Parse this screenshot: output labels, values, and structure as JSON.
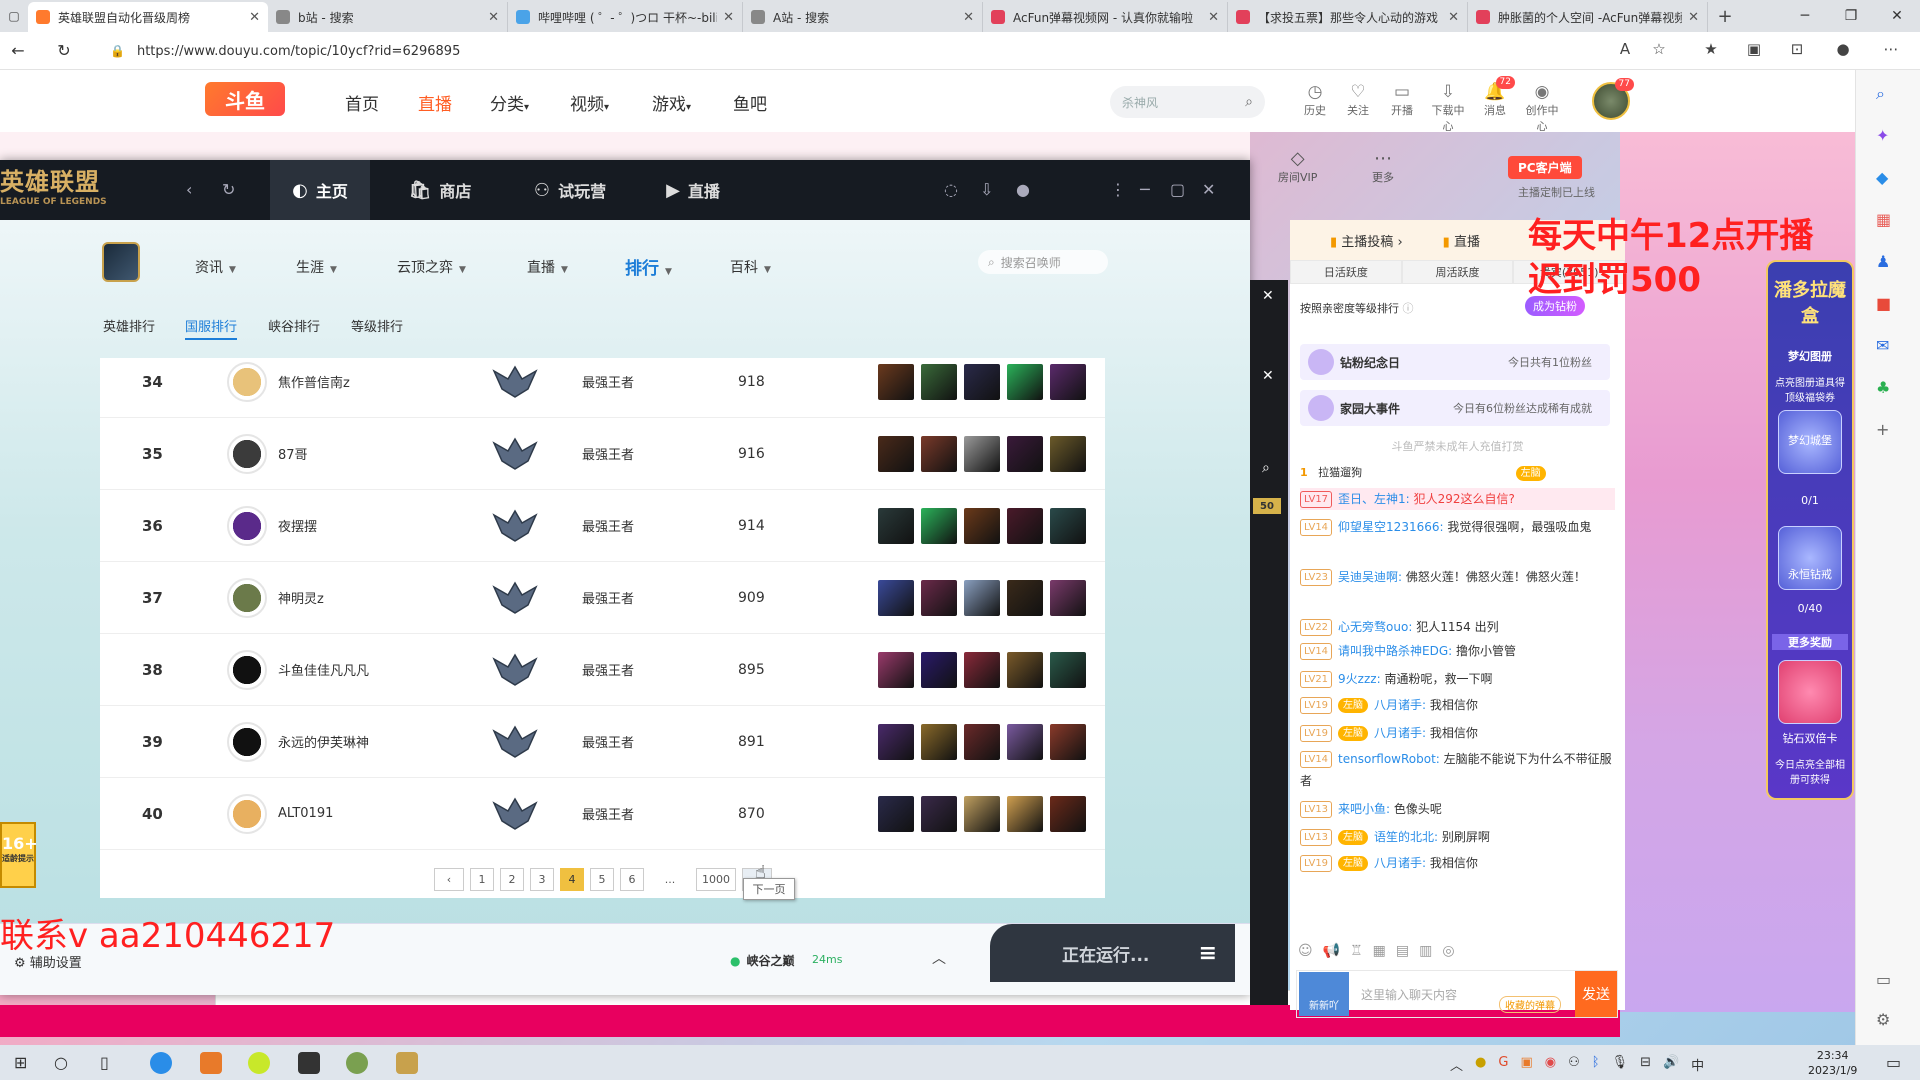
{
  "browser": {
    "tabs": [
      {
        "label": "英雄联盟自动化晋级周榜",
        "color": "#ff7a2d",
        "active": true
      },
      {
        "label": "b站 - 搜索",
        "color": "#888888"
      },
      {
        "label": "哔哩哔哩 ( ゜- ゜)つロ 干杯~-bili",
        "color": "#4aa3e8"
      },
      {
        "label": "A站 - 搜索",
        "color": "#888888"
      },
      {
        "label": "AcFun弹幕视频网 - 认真你就输啦",
        "color": "#e2405a"
      },
      {
        "label": "【求投五票】那些令人心动的游戏",
        "color": "#e2405a"
      },
      {
        "label": "肿胀菌的个人空间 -AcFun弹幕视频网",
        "color": "#e2405a"
      }
    ],
    "new_tab": "+",
    "url": "https://www.douyu.com/topic/10ycf?rid=6296895"
  },
  "douyu": {
    "logo": "斗鱼",
    "nav": [
      "首页",
      "直播",
      "分类",
      "视频",
      "游戏",
      "鱼吧"
    ],
    "active_nav": "直播",
    "search_placeholder": "杀神风",
    "header_icons": [
      {
        "label": "历史",
        "glyph": "◷"
      },
      {
        "label": "关注",
        "glyph": "♡"
      },
      {
        "label": "开播",
        "glyph": "▭"
      },
      {
        "label": "下载中心",
        "glyph": "⇩"
      },
      {
        "label": "消息",
        "glyph": "🔔",
        "badge": "72"
      },
      {
        "label": "创作中心",
        "glyph": "◉"
      }
    ],
    "avatar_badge": "77",
    "room_vip": "房间VIP",
    "more": "更多",
    "pc_client": "PC客户端",
    "pc_sub": "主播定制已上线"
  },
  "lol_client": {
    "logo": "英雄联盟",
    "logo_sub": "LEAGUE OF LEGENDS",
    "top_nav": [
      "主页",
      "商店",
      "试玩营",
      "直播"
    ],
    "active_top": "主页",
    "sub_nav": [
      "资讯",
      "生涯",
      "云顶之弈",
      "直播",
      "排行",
      "百科"
    ],
    "active_sub": "排行",
    "search_placeholder": "搜索召唤师",
    "rank_tabs": [
      "英雄排行",
      "国服排行",
      "峡谷排行",
      "等级排行"
    ],
    "active_rank_tab": "国服排行",
    "rows": [
      {
        "rank": "34",
        "name": "焦作普信南z",
        "tier": "最强王者",
        "score": "918",
        "avatar": "#e8c27a",
        "champs": [
          "#6b3a1e",
          "#3a6b3a",
          "#2a2a4a",
          "#2bb35a",
          "#5a2a6b"
        ]
      },
      {
        "rank": "35",
        "name": "87哥",
        "tier": "最强王者",
        "score": "916",
        "avatar": "#3b3b3b",
        "champs": [
          "#4a2a1a",
          "#7a3a2a",
          "#9a9a9a",
          "#3a1a3a",
          "#6b5a2a"
        ]
      },
      {
        "rank": "36",
        "name": "夜摆摆",
        "tier": "最强王者",
        "score": "914",
        "avatar": "#5a2a8a",
        "champs": [
          "#2a3a3a",
          "#2bb35a",
          "#6b3a1a",
          "#4a1a2a",
          "#2a4a4a"
        ]
      },
      {
        "rank": "37",
        "name": "神明灵z",
        "tier": "最强王者",
        "score": "909",
        "avatar": "#6b7a4a",
        "champs": [
          "#3a4a9a",
          "#6b2a4a",
          "#8aa0c0",
          "#3a2a1a",
          "#7a3a6b"
        ]
      },
      {
        "rank": "38",
        "name": "斗鱼佳佳凡凡凡",
        "tier": "最强王者",
        "score": "895",
        "avatar": "#111111",
        "champs": [
          "#9a3a6b",
          "#2a1a6b",
          "#8a2a3a",
          "#7a5a2a",
          "#2a5a4a"
        ]
      },
      {
        "rank": "39",
        "name": "永远的伊芙琳神",
        "tier": "最强王者",
        "score": "891",
        "avatar": "#111111",
        "champs": [
          "#4a2a6b",
          "#8a6a2a",
          "#6b2a2a",
          "#7a5aa0",
          "#8a3a2a"
        ]
      },
      {
        "rank": "40",
        "name": "ALT0191",
        "tier": "最强王者",
        "score": "870",
        "avatar": "#e8b060",
        "champs": [
          "#2a2a4a",
          "#3a2a4a",
          "#c0a060",
          "#d0a050",
          "#6b2a1a"
        ]
      }
    ],
    "pager": [
      "1",
      "2",
      "3",
      "4",
      "5",
      "6",
      "...",
      "1000"
    ],
    "active_page": "4",
    "prev_glyph": "‹",
    "next_glyph": "›",
    "next_tooltip": "下一页",
    "assist": "辅助设置",
    "server": "峡谷之巅",
    "ping": "24ms",
    "running": "正在运行...",
    "menu_glyph": "≡"
  },
  "overlay": {
    "top_right": [
      "每天中午12点开播",
      "迟到罚500"
    ],
    "bottom_left": "联系v  aa210446217",
    "age_rating": "16+",
    "age_sub": "适龄提示"
  },
  "chat": {
    "top_left": "主播投稿",
    "top_right": "直播",
    "tabs": [
      "日活跃度",
      "周活跃度",
      "贵宾(3951)"
    ],
    "sort_label": "按照亲密度等级排行",
    "join_btn": "成为钻粉",
    "events": [
      {
        "title": "钻粉纪念日",
        "sub": "今日共有1位粉丝"
      },
      {
        "title": "家园大事件",
        "sub": "今日有6位粉丝达成稀有成就"
      }
    ],
    "notice": "斗鱼严禁未成年人充值打赏",
    "fan_rank": "1",
    "fan_name": "拉猫遛狗",
    "fan_medal": "左脑",
    "level_badge": "50",
    "messages": [
      {
        "lv": "LV17",
        "user": "歪日、左神1:",
        "text": "犯人292这么自信?",
        "highlight": true
      },
      {
        "lv": "LV14",
        "user": "仰望星空1231666:",
        "text": "我觉得很强啊，最强吸血鬼"
      },
      {
        "lv": "LV23",
        "user": "吴迪吴迪啊:",
        "text": "佛怒火莲！佛怒火莲！佛怒火莲！"
      },
      {
        "lv": "LV22",
        "user": "心无旁骛ouo:",
        "text": "犯人1154  出列"
      },
      {
        "lv": "LV14",
        "user": "请叫我中路杀神EDG:",
        "text": "撸你小管管"
      },
      {
        "lv": "LV21",
        "user": "9火zzz:",
        "text": "南通粉呢，救一下啊"
      },
      {
        "lv": "LV19",
        "medal": "左脑",
        "user": "八月诸手:",
        "text": "我相信你"
      },
      {
        "lv": "LV19",
        "medal": "左脑",
        "user": "八月诸手:",
        "text": "我相信你"
      },
      {
        "lv": "LV14",
        "user": "tensorflowRobot:",
        "text": "左脑能不能说下为什么不带征服者"
      },
      {
        "lv": "LV13",
        "user": "来吧小鱼:",
        "text": "色像头呢"
      },
      {
        "lv": "LV13",
        "medal": "左脑",
        "user": "语笙的北北:",
        "text": "别刷屏啊"
      },
      {
        "lv": "LV19",
        "medal": "左脑",
        "user": "八月诸手:",
        "text": "我相信你"
      }
    ],
    "tools": [
      "☺",
      "📢",
      "♖",
      "▦",
      "▤",
      "▥",
      "◎"
    ],
    "input_placeholder": "这里输入聊天内容",
    "gift_tag": "收藏的弹幕",
    "new_label": "新新吖",
    "send": "发送"
  },
  "promo": {
    "title": "潘多拉魔盒",
    "items": [
      "梦幻图册",
      "点亮图册道具得顶级福袋券",
      "梦幻城堡",
      "0/1",
      "永恒钻戒",
      "0/40",
      "更多奖励",
      "钻石双倍卡",
      "今日点亮全部相册可获得"
    ]
  },
  "taskbar": {
    "time": "23:34",
    "date": "2023/1/9",
    "ime": "中"
  }
}
